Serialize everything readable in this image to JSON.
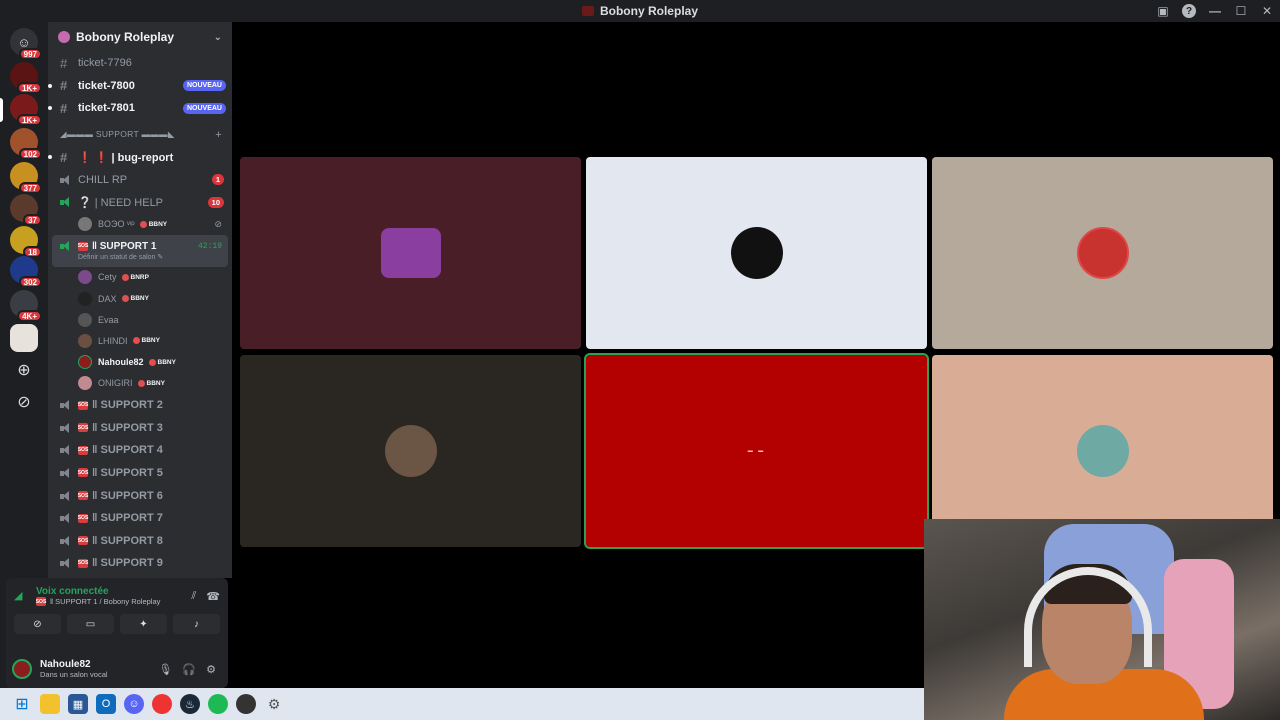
{
  "window": {
    "title": "Bobony Roleplay"
  },
  "guilds": {
    "badges": [
      "997",
      "1K+",
      "1K+",
      "102",
      "377",
      "37",
      "18",
      "302",
      "4K+"
    ]
  },
  "server": {
    "name": "Bobony Roleplay",
    "channels_top": [
      {
        "name": "ticket-7796",
        "unread": false,
        "new_label": ""
      },
      {
        "name": "ticket-7800",
        "unread": true,
        "new_label": "NOUVEAU"
      },
      {
        "name": "ticket-7801",
        "unread": true,
        "new_label": "NOUVEAU"
      }
    ],
    "category": "◢▬▬▬ SUPPORT ▬▬▬◣",
    "bug_report": "❗ ❗ | bug-report",
    "chill": {
      "name": "CHILL RP",
      "count": "1"
    },
    "need_help": {
      "name": "❔ | NEED HELP",
      "count": "10"
    },
    "need_help_member": {
      "name": "BOЭO ᵛᶦᵖ",
      "tag": "BBNY"
    },
    "active": {
      "name": "‖ SUPPORT 1",
      "time": "42:19",
      "status": "Définir un statut de salon ✎"
    },
    "members": [
      {
        "name": "Cety",
        "tag": "BNRP",
        "color": "#7a4a8a"
      },
      {
        "name": "DAX",
        "tag": "BBNY",
        "color": "#222"
      },
      {
        "name": "Evaa",
        "tag": "",
        "color": "#555"
      },
      {
        "name": "LHINDI",
        "tag": "BBNY",
        "color": "#6a5040"
      },
      {
        "name": "Nahoule82",
        "tag": "BBNY",
        "color": "#8a1d1d"
      },
      {
        "name": "ONIGIRI",
        "tag": "BBNY",
        "color": "#c08a90"
      }
    ],
    "support_channels": [
      "‖ SUPPORT 2",
      "‖ SUPPORT 3",
      "‖ SUPPORT 4",
      "‖ SUPPORT 5",
      "‖ SUPPORT 6",
      "‖ SUPPORT 7",
      "‖ SUPPORT 8",
      "‖ SUPPORT 9"
    ]
  },
  "voice_panel": {
    "title": "Voix connectée",
    "subtitle": "‖ SUPPORT 1 / Bobony Roleplay"
  },
  "user": {
    "name": "Nahoule82",
    "status": "Dans un salon vocal"
  },
  "stage": {
    "tiles": [
      {
        "bg": "#4a1e26",
        "avatar": "#8a3fa0"
      },
      {
        "bg": "#e3e7ef",
        "avatar": "#111"
      },
      {
        "bg": "#b4a99a",
        "avatar": "#c8322f"
      },
      {
        "bg": "#2a2622",
        "avatar": "#6b5545"
      },
      {
        "bg": "#b30000",
        "avatar": ""
      },
      {
        "bg": "#d9ad95",
        "avatar": "#6fa9a4"
      }
    ]
  },
  "colors": {
    "accent": "#5865f2",
    "online": "#23a55a",
    "danger": "#da373c"
  }
}
